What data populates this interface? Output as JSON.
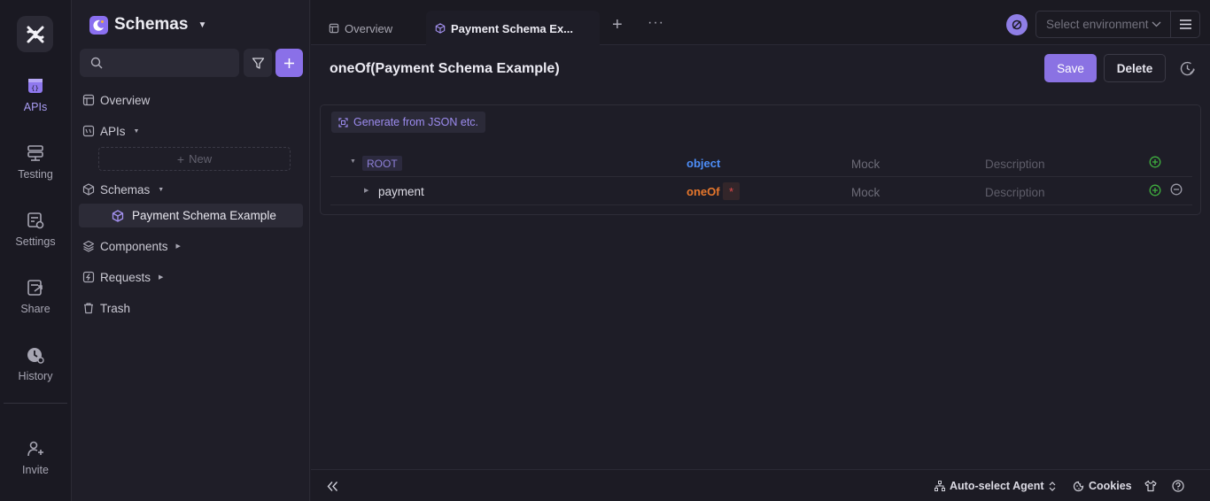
{
  "rail": {
    "items": [
      {
        "label": "APIs",
        "icon": "apis-icon",
        "active": true
      },
      {
        "label": "Testing",
        "icon": "testing-icon"
      },
      {
        "label": "Settings",
        "icon": "settings-icon"
      },
      {
        "label": "Share",
        "icon": "share-icon"
      },
      {
        "label": "History",
        "icon": "history-icon"
      },
      {
        "label": "Invite",
        "icon": "invite-icon"
      }
    ]
  },
  "sidebar": {
    "workspace_title": "Schemas",
    "search": {
      "placeholder": "",
      "value": ""
    },
    "tree": {
      "overview": "Overview",
      "apis": "APIs",
      "new_label": "New",
      "schemas": "Schemas",
      "active_schema": "Payment Schema Example",
      "components": "Components",
      "requests": "Requests",
      "trash": "Trash"
    }
  },
  "tabs": {
    "overview": "Overview",
    "active": "Payment Schema Ex..."
  },
  "environment": {
    "placeholder": "Select environment"
  },
  "page": {
    "title": "oneOf(Payment Schema Example)",
    "save_label": "Save",
    "delete_label": "Delete"
  },
  "schema": {
    "generate_label": "Generate from JSON etc.",
    "rows": [
      {
        "name": "ROOT",
        "type": "object",
        "mock": "Mock",
        "description": "Description"
      },
      {
        "name": "payment",
        "type": "oneOf",
        "required_mark": "*",
        "mock": "Mock",
        "description": "Description"
      }
    ]
  },
  "statusbar": {
    "agent_label": "Auto-select Agent",
    "cookies_label": "Cookies"
  },
  "colors": {
    "accent": "#8a72e3",
    "object_type": "#4d8df6",
    "oneof_type": "#e7772c",
    "add_icon": "#3fae3f"
  }
}
